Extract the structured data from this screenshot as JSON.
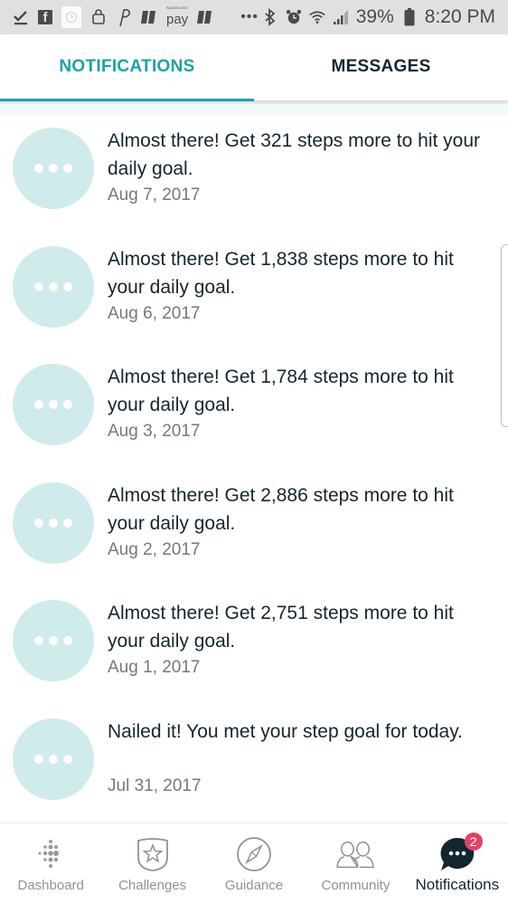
{
  "status_bar": {
    "battery": "39%",
    "time": "8:20 PM",
    "pay_label": "pay",
    "pay_brand": "SAMSUNG",
    "overflow": "•••",
    "icons": [
      "download-done-icon",
      "facebook-icon",
      "clock-app-icon",
      "shopping-bag-icon",
      "paypal-icon",
      "app-icon",
      "samsung-pay-icon",
      "app-icon",
      "bluetooth-icon",
      "alarm-icon",
      "wifi-icon",
      "signal-icon",
      "battery-icon"
    ]
  },
  "tabs": [
    {
      "label": "NOTIFICATIONS",
      "active": true
    },
    {
      "label": "MESSAGES",
      "active": false
    }
  ],
  "notifications": [
    {
      "message": "Almost there! Get 321 steps more to hit your daily goal.",
      "date": "Aug 7, 2017"
    },
    {
      "message": "Almost there! Get 1,838 steps more to hit your daily goal.",
      "date": "Aug 6, 2017"
    },
    {
      "message": "Almost there! Get 1,784 steps more to hit your daily goal.",
      "date": "Aug 3, 2017"
    },
    {
      "message": "Almost there! Get 2,886 steps more to hit your daily goal.",
      "date": "Aug 2, 2017"
    },
    {
      "message": "Almost there! Get 2,751 steps more to hit your daily goal.",
      "date": "Aug 1, 2017"
    },
    {
      "message": "Nailed it! You met your step goal for today.",
      "date": "Jul 31, 2017"
    }
  ],
  "bottom_nav": [
    {
      "label": "Dashboard",
      "icon": "dashboard-dots-icon",
      "active": false
    },
    {
      "label": "Challenges",
      "icon": "challenges-shield-star-icon",
      "active": false
    },
    {
      "label": "Guidance",
      "icon": "guidance-compass-icon",
      "active": false
    },
    {
      "label": "Community",
      "icon": "community-people-icon",
      "active": false
    },
    {
      "label": "Notifications",
      "icon": "notifications-chat-icon",
      "active": true,
      "badge": "2"
    }
  ],
  "colors": {
    "accent": "#1aa3a8",
    "avatar_bg": "#cfebeb",
    "badge": "#e2416a",
    "text_dark": "#13262f"
  }
}
